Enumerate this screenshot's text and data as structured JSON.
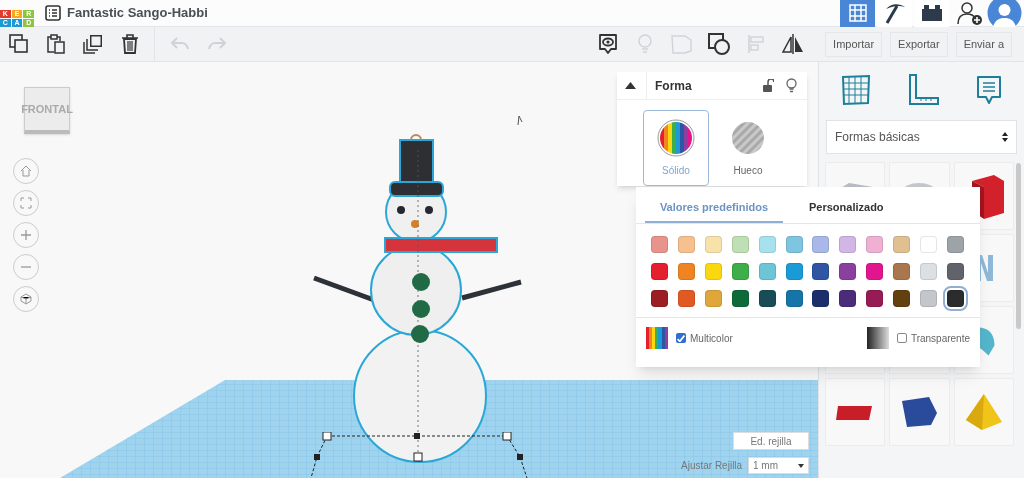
{
  "header": {
    "logo_letters": [
      "K",
      "E",
      "R",
      "C",
      "A",
      "D"
    ],
    "title": "Fantastic Sango-Habbi",
    "view_modes": [
      {
        "kind": "grid",
        "selected": true
      },
      {
        "kind": "pickaxe",
        "selected": false
      },
      {
        "kind": "bricks",
        "selected": false
      }
    ]
  },
  "toolbar": {
    "actions": [
      {
        "kind": "copy",
        "disabled": false
      },
      {
        "kind": "paste",
        "disabled": false
      },
      {
        "kind": "duplicate",
        "disabled": false
      },
      {
        "kind": "delete",
        "disabled": false
      },
      {
        "kind": "undo",
        "disabled": true
      },
      {
        "kind": "redo",
        "disabled": true
      }
    ],
    "view_actions": [
      {
        "kind": "note",
        "disabled": false
      },
      {
        "kind": "bulb",
        "disabled": true
      },
      {
        "kind": "group",
        "disabled": true
      },
      {
        "kind": "hole",
        "disabled": false
      },
      {
        "kind": "align",
        "disabled": true
      },
      {
        "kind": "mirror",
        "disabled": false
      }
    ],
    "buttons": [
      "Importar",
      "Exportar",
      "Enviar a"
    ]
  },
  "view_cube": {
    "label": "FRONTAL"
  },
  "inspector": {
    "title": "Forma",
    "expanded": true,
    "modes": [
      {
        "kind": "solid",
        "label": "Sólido",
        "selected": true
      },
      {
        "kind": "hole",
        "label": "Hueco",
        "selected": false
      }
    ]
  },
  "color_popup": {
    "tabs": [
      {
        "label": "Valores predefinidos",
        "selected": true
      },
      {
        "label": "Personalizado",
        "selected": false
      }
    ],
    "swatches": [
      {
        "color": "#e8938b",
        "selected": false
      },
      {
        "color": "#f6c08f",
        "selected": false
      },
      {
        "color": "#f7e2aa",
        "selected": false
      },
      {
        "color": "#bfe0b4",
        "selected": false
      },
      {
        "color": "#a7e1ef",
        "selected": false
      },
      {
        "color": "#7ec5e2",
        "selected": false
      },
      {
        "color": "#a9b7e9",
        "selected": false
      },
      {
        "color": "#d2b6e5",
        "selected": false
      },
      {
        "color": "#efb0d3",
        "selected": false
      },
      {
        "color": "#e0c091",
        "selected": false
      },
      {
        "color": "#ffffff",
        "selected": false
      },
      {
        "color": "#9ea3a8",
        "selected": false
      },
      {
        "color": "#e4202e",
        "selected": false
      },
      {
        "color": "#f08423",
        "selected": false
      },
      {
        "color": "#fbd80d",
        "selected": false
      },
      {
        "color": "#3dae49",
        "selected": false
      },
      {
        "color": "#6ec5d9",
        "selected": false
      },
      {
        "color": "#1a9ad7",
        "selected": false
      },
      {
        "color": "#2f56a3",
        "selected": false
      },
      {
        "color": "#8a40a0",
        "selected": false
      },
      {
        "color": "#e2158f",
        "selected": false
      },
      {
        "color": "#a9764d",
        "selected": false
      },
      {
        "color": "#dde0e3",
        "selected": false
      },
      {
        "color": "#60646a",
        "selected": false
      },
      {
        "color": "#9b1e23",
        "selected": false
      },
      {
        "color": "#e25a23",
        "selected": false
      },
      {
        "color": "#dfa73a",
        "selected": false
      },
      {
        "color": "#0f6a3a",
        "selected": false
      },
      {
        "color": "#184d57",
        "selected": false
      },
      {
        "color": "#1675a8",
        "selected": false
      },
      {
        "color": "#1c2f6b",
        "selected": false
      },
      {
        "color": "#4b2c7a",
        "selected": false
      },
      {
        "color": "#971b54",
        "selected": false
      },
      {
        "color": "#62400f",
        "selected": false
      },
      {
        "color": "#c3c7cb",
        "selected": false
      },
      {
        "color": "#2b2c2e",
        "selected": true
      }
    ],
    "multicolor": {
      "label": "Multicolor",
      "checked": true
    },
    "transparent": {
      "label": "Transparente",
      "checked": false
    }
  },
  "library": {
    "category": "Formas básicas"
  },
  "grid_controls": {
    "edit_label": "Ed. rejilla",
    "snap_label": "Ajustar Rejilla",
    "snap_value": "1 mm"
  }
}
